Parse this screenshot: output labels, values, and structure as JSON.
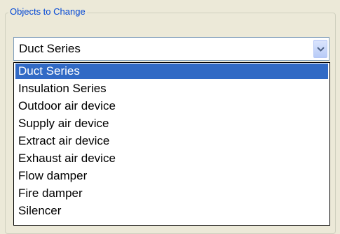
{
  "groupbox": {
    "title": "Objects to Change"
  },
  "combo": {
    "value": "Duct Series",
    "expanded": true
  },
  "dropdown": {
    "items": [
      "Duct Series",
      "Insulation Series",
      "Outdoor air device",
      "Supply air device",
      "Extract air device",
      "Exhaust air device",
      "Flow damper",
      "Fire damper",
      "Silencer"
    ],
    "selected": "Duct Series"
  },
  "colors": {
    "selection": "#316ac5",
    "legend_text": "#0046d5"
  }
}
